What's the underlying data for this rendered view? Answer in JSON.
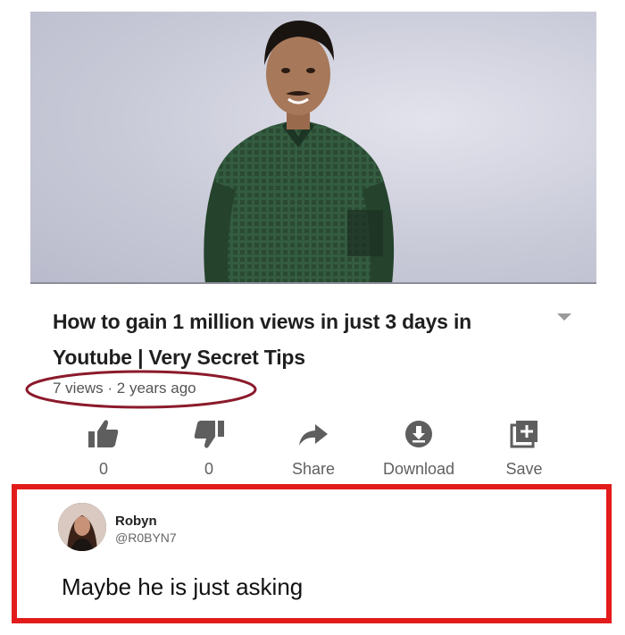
{
  "video": {
    "title_line1": "How to gain 1 million views in just 3 days in",
    "title_line2": "Youtube | Very Secret Tips",
    "meta": "7 views · 2 years ago",
    "thumbnail_icon": "person-photo",
    "expand_icon": "dropdown-triangle-icon"
  },
  "actions": [
    {
      "icon": "thumbs-up-icon",
      "label": "0"
    },
    {
      "icon": "thumbs-down-icon",
      "label": "0"
    },
    {
      "icon": "share-arrow-icon",
      "label": "Share"
    },
    {
      "icon": "download-icon",
      "label": "Download"
    },
    {
      "icon": "add-to-playlist-icon",
      "label": "Save"
    }
  ],
  "tweet": {
    "name": "Robyn",
    "handle": "@R0BYN7",
    "text": "Maybe he is just asking",
    "avatar_icon": "avatar"
  },
  "colors": {
    "highlight_border": "#e31b1b",
    "circle_annotation": "#8b1a2b",
    "text_primary": "#1f1f1f",
    "text_secondary": "#606060"
  }
}
